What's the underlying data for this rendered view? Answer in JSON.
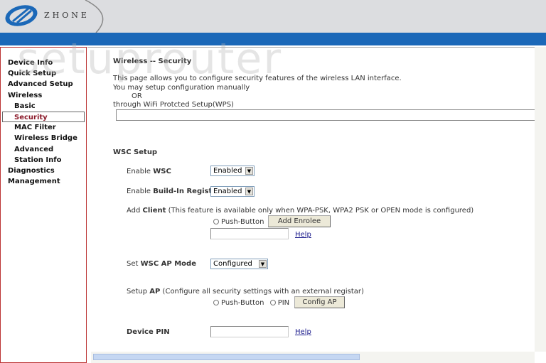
{
  "brand": {
    "logo_text": "ZHONE",
    "watermark": "setuprouter"
  },
  "sidebar": {
    "items": [
      {
        "label": "Device Info",
        "sub": false
      },
      {
        "label": "Quick Setup",
        "sub": false
      },
      {
        "label": "Advanced Setup",
        "sub": false
      },
      {
        "label": "Wireless",
        "sub": false
      },
      {
        "label": "Basic",
        "sub": true
      },
      {
        "label": "Security",
        "sub": true,
        "active": true
      },
      {
        "label": "MAC Filter",
        "sub": true
      },
      {
        "label": "Wireless Bridge",
        "sub": true
      },
      {
        "label": "Advanced",
        "sub": true
      },
      {
        "label": "Station Info",
        "sub": true
      },
      {
        "label": "Diagnostics",
        "sub": false
      },
      {
        "label": "Management",
        "sub": false
      }
    ]
  },
  "page": {
    "title": "Wireless -- Security",
    "intro1": "This page allows you to configure security features of the wireless LAN interface.",
    "intro2": "You may setup configuration manually",
    "or": "OR",
    "intro3": "through WiFi Protcted Setup(WPS)",
    "wsc_heading": "WSC Setup",
    "enable_wsc_label": "Enable ",
    "enable_wsc_bold": "WSC",
    "enable_wsc_value": "Enabled",
    "registrar_label": "Enable ",
    "registrar_bold": "Build-In Registrar",
    "registrar_value": "Enabled",
    "add_client_label": "Add ",
    "add_client_bold": "Client",
    "add_client_note": " (This feature is available only when WPA-PSK, WPA2 PSK or OPEN mode is configured)",
    "push_button": "Push-Button",
    "pin": "PIN",
    "add_enrolee": "Add Enrolee",
    "help": "Help",
    "ap_mode_label": "Set ",
    "ap_mode_bold": "WSC AP Mode",
    "ap_mode_value": "Configured",
    "setup_ap_label": "Setup ",
    "setup_ap_bold": "AP",
    "setup_ap_note": " (Configure all security settings with an external registar)",
    "config_ap": "Config AP",
    "device_pin_label": "Device PIN",
    "colors": {
      "blue_bar": "#1b68b8",
      "active_nav": "#8b1a2a"
    }
  }
}
